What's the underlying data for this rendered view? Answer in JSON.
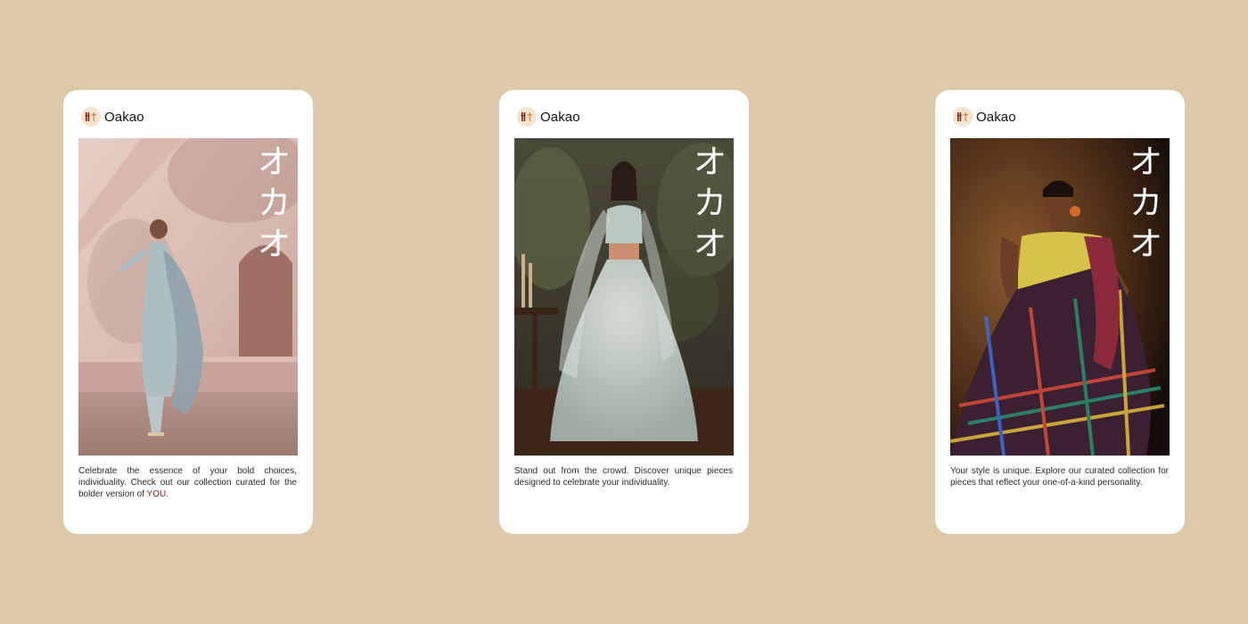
{
  "background_color": "#dbc9aa",
  "cards": [
    {
      "brand_name": "Oakao",
      "brand_icon": "oakao-logo-icon",
      "katakana": [
        "オ",
        "カ",
        "オ"
      ],
      "photo_description_icon": "model-photo-icon",
      "caption_text": "Celebrate the essence of your bold choices, individuality. Check out our collection curated for the bolder version of ",
      "caption_emphasis": "YOU",
      "caption_end": "."
    },
    {
      "brand_name": "Oakao",
      "brand_icon": "oakao-logo-icon",
      "katakana": [
        "オ",
        "カ",
        "オ"
      ],
      "photo_description_icon": "model-photo-icon",
      "caption_text": "Stand out from the crowd. Discover unique pieces designed to celebrate your individuality."
    },
    {
      "brand_name": "Oakao",
      "brand_icon": "oakao-logo-icon",
      "katakana": [
        "オ",
        "カ",
        "オ"
      ],
      "photo_description_icon": "model-photo-icon",
      "caption_text": "Your style is unique. Explore our curated collection for pieces that reflect your one-of-a-kind personality."
    }
  ]
}
